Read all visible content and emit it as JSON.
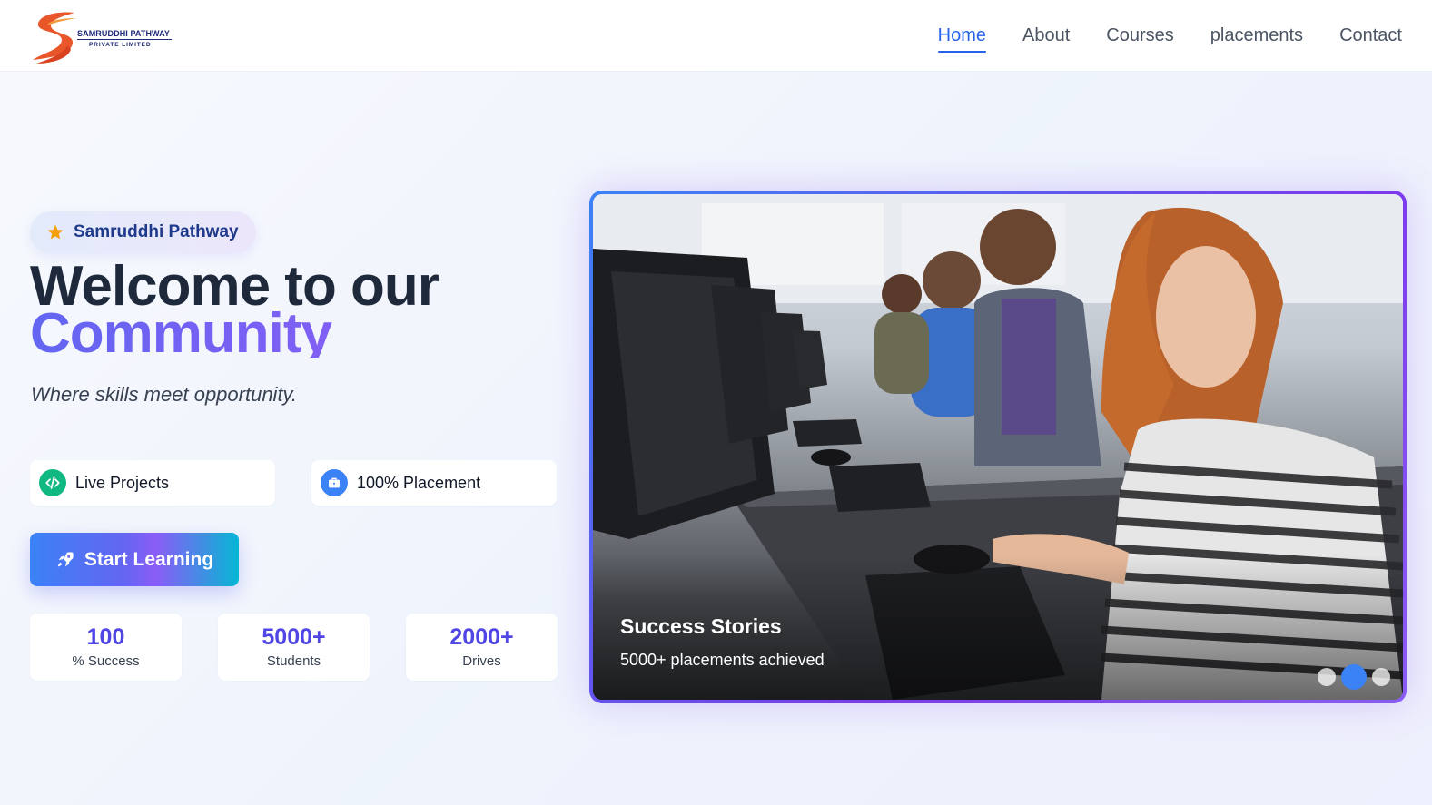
{
  "brand": {
    "name_line1": "SAMRUDDHI PATHWAY",
    "name_line2": "PRIVATE LIMITED"
  },
  "nav": {
    "items": [
      {
        "label": "Home",
        "active": true
      },
      {
        "label": "About",
        "active": false
      },
      {
        "label": "Courses",
        "active": false
      },
      {
        "label": "placements",
        "active": false
      },
      {
        "label": "Contact",
        "active": false
      }
    ]
  },
  "hero": {
    "badge": {
      "icon": "star-icon",
      "label": "Samruddhi Pathway"
    },
    "title_line1": "Welcome to our",
    "title_line2": "Community",
    "subtitle": "Where skills meet opportunity.",
    "features": [
      {
        "icon": "code-icon",
        "label": "Live Projects"
      },
      {
        "icon": "briefcase-icon",
        "label": "100% Placement"
      }
    ],
    "cta": {
      "icon": "rocket-icon",
      "label": "Start Learning"
    },
    "stats": [
      {
        "value": "100",
        "label": "% Success"
      },
      {
        "value": "5000+",
        "label": "Students"
      },
      {
        "value": "2000+",
        "label": "Drives"
      }
    ]
  },
  "carousel": {
    "slide_title": "Success Stories",
    "slide_caption": "5000+ placements achieved",
    "dot_count": 3,
    "active_dot": 2
  },
  "colors": {
    "accent": "#2563eb",
    "brand_indigo": "#4f46e5",
    "gradient_purple": "#8b5cf6",
    "title_dark": "#1e293b",
    "logo_orange": "#e8562a"
  }
}
